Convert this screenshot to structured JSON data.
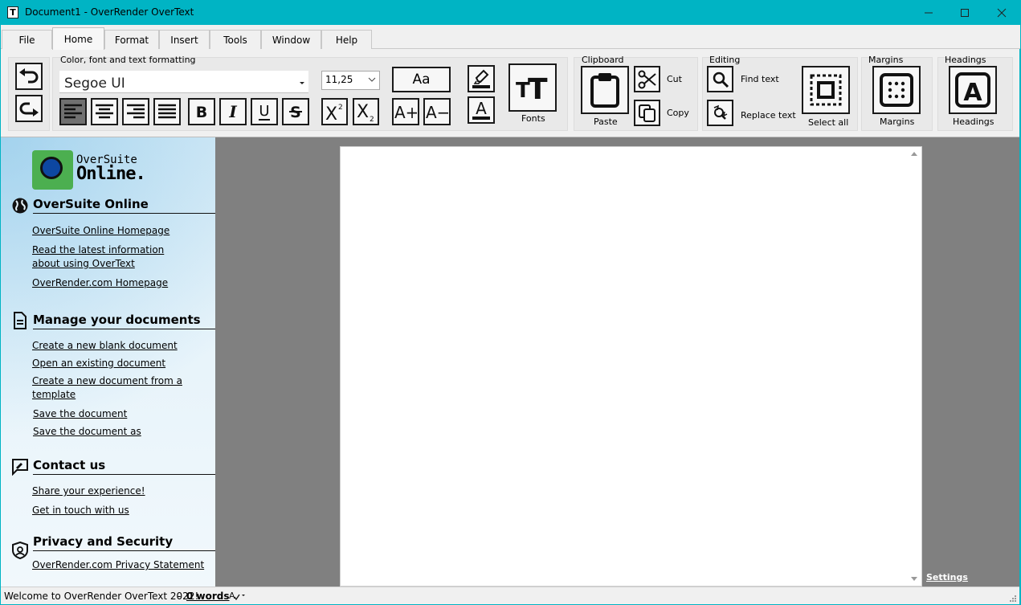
{
  "window": {
    "title": "Document1 - OverRender OverText",
    "app_icon_glyph": "T"
  },
  "menu": {
    "tabs": [
      "File",
      "Home",
      "Format",
      "Insert",
      "Tools",
      "Window",
      "Help"
    ],
    "active": "Home"
  },
  "ribbon": {
    "formatting_group_label": "Color, font and text formatting",
    "font_name": "Segoe UI",
    "font_size": "11,25",
    "case_label": "Aa",
    "fonts_label": "Fonts",
    "clipboard": {
      "label": "Clipboard",
      "paste": "Paste",
      "cut": "Cut",
      "copy": "Copy"
    },
    "editing": {
      "label": "Editing",
      "find": "Find text",
      "replace": "Replace text",
      "select_all": "Select all"
    },
    "margins": {
      "label": "Margins",
      "button": "Margins"
    },
    "headings": {
      "label": "Headings",
      "button": "Headings"
    }
  },
  "sidebar": {
    "logo": {
      "line1": "OverSuite",
      "line2": "Online."
    },
    "sections": [
      {
        "title": "OverSuite Online",
        "links": [
          "OverSuite Online Homepage",
          "Read the latest information",
          "about using OverText",
          "OverRender.com Homepage"
        ]
      },
      {
        "title": "Manage your documents",
        "links": [
          "Create a new blank document",
          "Open an existing document",
          "Create a new document from a",
          "template",
          "Save the document",
          "Save the document as"
        ]
      },
      {
        "title": "Contact us",
        "links": [
          "Share your experience!",
          "Get in touch with us"
        ]
      },
      {
        "title": "Privacy and Security",
        "links": [
          "OverRender.com Privacy Statement"
        ]
      }
    ]
  },
  "document": {
    "settings_link": "Settings"
  },
  "status": {
    "welcome": "Welcome to OverRender OverText 2022!",
    "separator": "-",
    "words": "0 words"
  },
  "colors": {
    "accent": "#00b4c4",
    "doc_background": "#808080",
    "ribbon": "#f0f0f0"
  }
}
